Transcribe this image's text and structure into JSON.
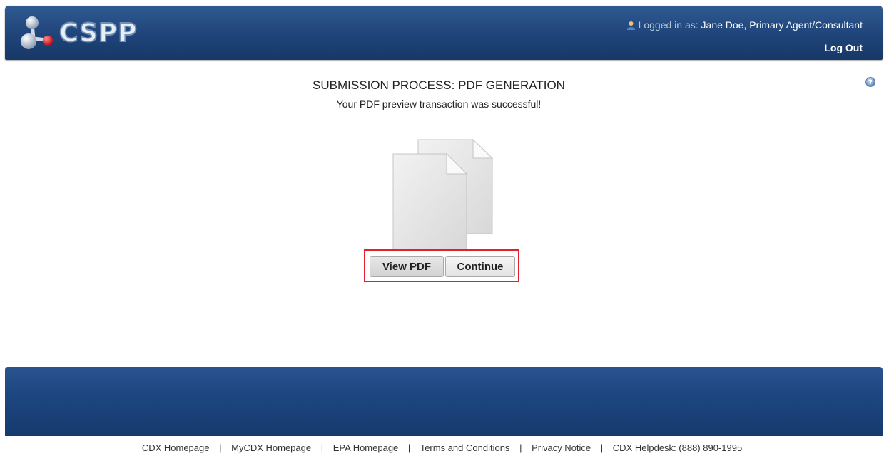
{
  "header": {
    "logo_text": "CSPP",
    "logged_in_label": "Logged in as:",
    "user": "Jane Doe, Primary Agent/Consultant",
    "logout_label": "Log Out"
  },
  "main": {
    "title": "SUBMISSION PROCESS: PDF GENERATION",
    "subtitle": "Your PDF preview transaction was successful!",
    "view_pdf_label": "View PDF",
    "continue_label": "Continue"
  },
  "footer": {
    "links": [
      {
        "label": "CDX Homepage"
      },
      {
        "label": "MyCDX Homepage"
      },
      {
        "label": "EPA Homepage"
      },
      {
        "label": "Terms and Conditions"
      },
      {
        "label": "Privacy Notice"
      },
      {
        "label": "CDX Helpdesk: (888) 890-1995"
      }
    ],
    "separator": "|"
  },
  "icons": {
    "logo": "molecule-icon",
    "user": "user-icon",
    "help": "help-icon",
    "document": "pdf-document-icon"
  },
  "colors": {
    "header_blue": "#1f4479",
    "highlight_border": "#e3202e"
  }
}
